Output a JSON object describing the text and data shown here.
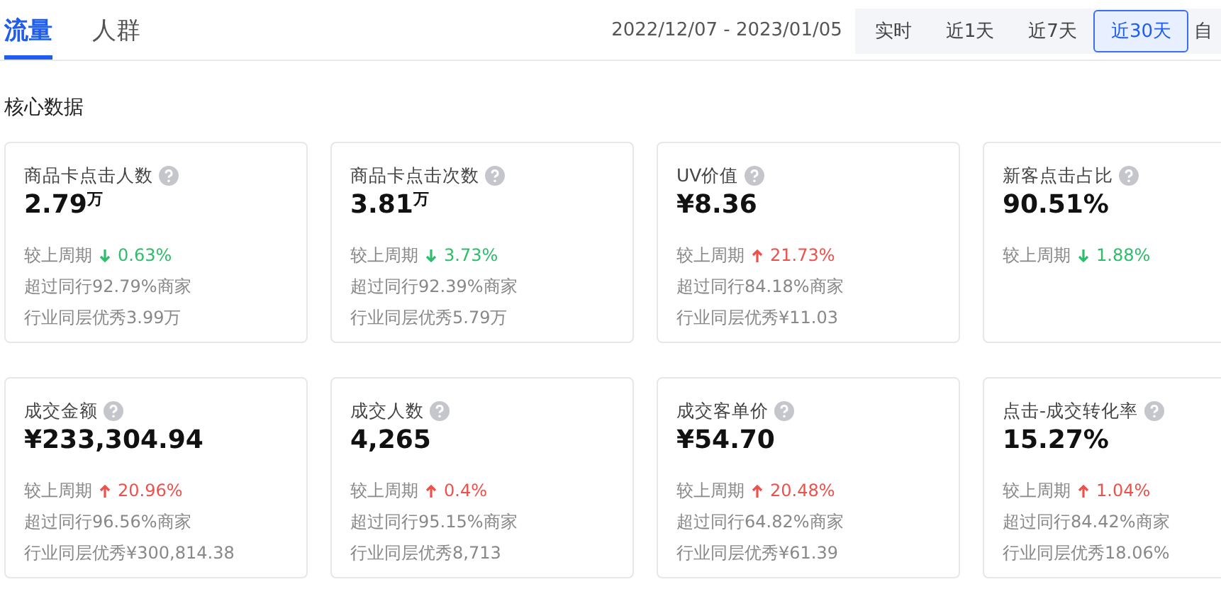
{
  "tabs": [
    {
      "label": "流量",
      "selected": true
    },
    {
      "label": "人群",
      "selected": false
    }
  ],
  "date_range": "2022/12/07 - 2023/01/05",
  "periods": [
    {
      "label": "实时",
      "selected": false
    },
    {
      "label": "近1天",
      "selected": false
    },
    {
      "label": "近7天",
      "selected": false
    },
    {
      "label": "近30天",
      "selected": true
    },
    {
      "label": "自",
      "selected": false
    }
  ],
  "section_title": "核心数据",
  "cards": [
    {
      "title": "商品卡点击人数",
      "value": "2.79$^{万}$",
      "compare_label": "较上周期",
      "kind": "down",
      "change": "0.63%",
      "peer_rank": "超过同行92.79%商家",
      "peer_best": "行业同层优秀3.99万"
    },
    {
      "title": "商品卡点击次数",
      "value": "3.81$^{万}$",
      "compare_label": "较上周期",
      "kind": "down",
      "change": "3.73%",
      "peer_rank": "超过同行92.39%商家",
      "peer_best": "行业同层优秀5.79万"
    },
    {
      "title": "UV价值",
      "value": "¥8.36",
      "compare_label": "较上周期",
      "kind": "up",
      "change": "21.73%",
      "peer_rank": "超过同行84.18%商家",
      "peer_best": "行业同层优秀¥11.03"
    },
    {
      "title": "新客点击占比",
      "value": "90.51%",
      "compare_label": "较上周期",
      "kind": "down",
      "change": "1.88%"
    },
    {
      "title": "成交金额",
      "value": "¥233,304.94",
      "compare_label": "较上周期",
      "kind": "up",
      "change": "20.96%",
      "peer_rank": "超过同行96.56%商家",
      "peer_best": "行业同层优秀¥300,814.38"
    },
    {
      "title": "成交人数",
      "value": "4,265",
      "compare_label": "较上周期",
      "kind": "up",
      "change": "0.4%",
      "peer_rank": "超过同行95.15%商家",
      "peer_best": "行业同层优秀8,713"
    },
    {
      "title": "成交客单价",
      "value": "¥54.70",
      "compare_label": "较上周期",
      "kind": "up",
      "change": "20.48%",
      "peer_rank": "超过同行64.82%商家",
      "peer_best": "行业同层优秀¥61.39"
    },
    {
      "title": "点击-成交转化率",
      "value": "15.27%",
      "compare_label": "较上周期",
      "kind": "up",
      "change": "1.04%",
      "peer_rank": "超过同行84.42%商家",
      "peer_best": "行业同层优秀18.06%"
    }
  ]
}
